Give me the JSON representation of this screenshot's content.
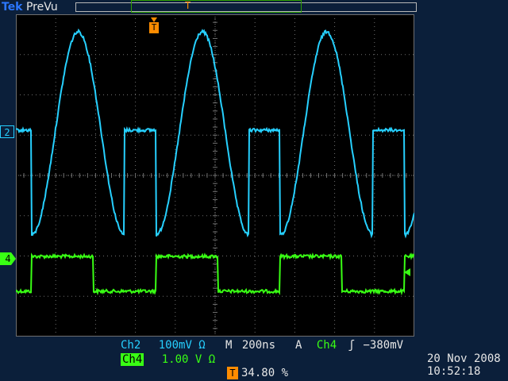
{
  "header": {
    "brand": "Tek",
    "mode": "PreVu",
    "trigger_glyph": "T"
  },
  "markers": {
    "ch2": "2",
    "ch4": "4",
    "trigger": "T"
  },
  "settings": {
    "ch2_label": "Ch2",
    "ch2_scale": "100mV Ω",
    "ch4_label": "Ch4",
    "ch4_scale": "1.00 V Ω",
    "timebase_label": "M",
    "timebase_value": "200ns",
    "trigger_source_label": "A",
    "trigger_source": "Ch4",
    "trigger_slope": "ʃ",
    "trigger_level": "−380mV",
    "position_label": "T",
    "position_value": "34.80 %"
  },
  "timestamp": {
    "date": "20 Nov 2008",
    "time": "10:52:18"
  },
  "colors": {
    "ch2": "#26d0ff",
    "ch4": "#39ff14",
    "trigger": "#ff8c00",
    "grid": "#6f6f6f",
    "background": "#0b1f3a"
  }
}
